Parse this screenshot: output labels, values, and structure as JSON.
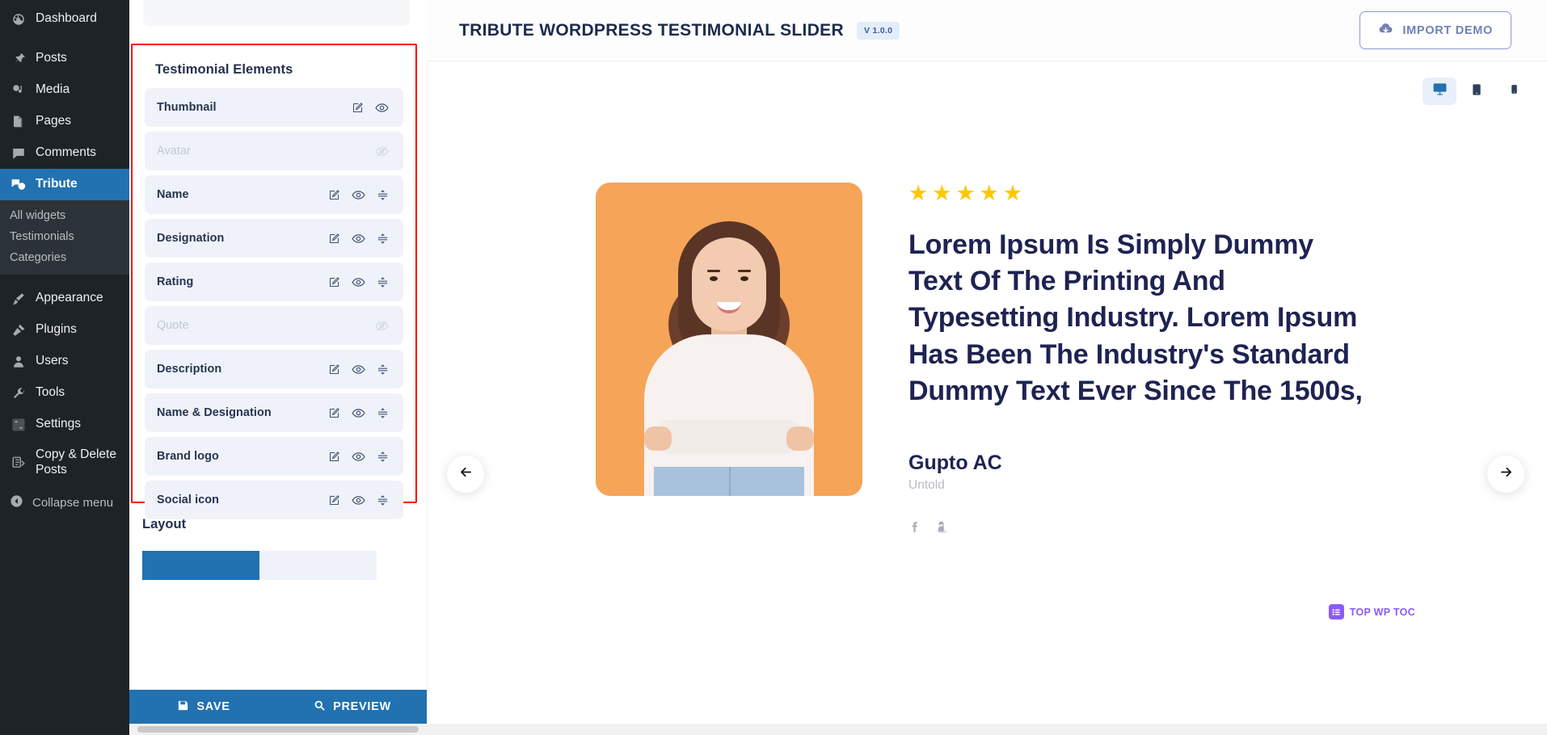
{
  "wp_sidebar": {
    "items": [
      {
        "label": "Dashboard",
        "icon": "dashboard-icon"
      },
      {
        "label": "Posts",
        "icon": "pin-icon"
      },
      {
        "label": "Media",
        "icon": "media-icon"
      },
      {
        "label": "Pages",
        "icon": "pages-icon"
      },
      {
        "label": "Comments",
        "icon": "comments-icon"
      },
      {
        "label": "Tribute",
        "icon": "tribute-icon",
        "active": true
      }
    ],
    "submenu": [
      {
        "label": "All widgets"
      },
      {
        "label": "Testimonials"
      },
      {
        "label": "Categories"
      }
    ],
    "items2": [
      {
        "label": "Appearance",
        "icon": "brush-icon"
      },
      {
        "label": "Plugins",
        "icon": "plug-icon"
      },
      {
        "label": "Users",
        "icon": "user-icon"
      },
      {
        "label": "Tools",
        "icon": "wrench-icon"
      },
      {
        "label": "Settings",
        "icon": "sliders-icon"
      },
      {
        "label": "Copy & Delete Posts",
        "icon": "copy-icon"
      }
    ],
    "collapse_label": "Collapse menu"
  },
  "left_panel": {
    "elements_heading": "Testimonial Elements",
    "elements": [
      {
        "label": "Thumbnail",
        "enabled": true,
        "has_edit": true,
        "has_eye": true,
        "has_drag": false
      },
      {
        "label": "Avatar",
        "enabled": false,
        "has_edit": false,
        "has_eye": true,
        "has_drag": false
      },
      {
        "label": "Name",
        "enabled": true,
        "has_edit": true,
        "has_eye": true,
        "has_drag": true
      },
      {
        "label": "Designation",
        "enabled": true,
        "has_edit": true,
        "has_eye": true,
        "has_drag": true
      },
      {
        "label": "Rating",
        "enabled": true,
        "has_edit": true,
        "has_eye": true,
        "has_drag": true
      },
      {
        "label": "Quote",
        "enabled": false,
        "has_edit": false,
        "has_eye": true,
        "has_drag": false
      },
      {
        "label": "Description",
        "enabled": true,
        "has_edit": true,
        "has_eye": true,
        "has_drag": true
      },
      {
        "label": "Name & Designation",
        "enabled": true,
        "has_edit": true,
        "has_eye": true,
        "has_drag": true
      },
      {
        "label": "Brand logo",
        "enabled": true,
        "has_edit": true,
        "has_eye": true,
        "has_drag": true
      },
      {
        "label": "Social icon",
        "enabled": true,
        "has_edit": true,
        "has_eye": true,
        "has_drag": true
      }
    ],
    "layout_heading": "Layout",
    "save_label": "SAVE",
    "preview_label": "PREVIEW"
  },
  "header": {
    "title": "TRIBUTE WORDPRESS TESTIMONIAL SLIDER",
    "version": "V 1.0.0",
    "import_label": "IMPORT DEMO"
  },
  "devices": [
    {
      "name": "desktop",
      "active": true
    },
    {
      "name": "tablet",
      "active": false
    },
    {
      "name": "mobile",
      "active": false
    }
  ],
  "testimonial": {
    "rating": 5,
    "stars": [
      "★",
      "★",
      "★",
      "★",
      "★"
    ],
    "quote": "Lorem Ipsum Is Simply Dummy Text Of The Printing And Typesetting Industry. Lorem Ipsum Has Been The Industry's Standard Dummy Text Ever Since The 1500s,",
    "author": "Gupto AC",
    "role": "Untold",
    "socials": [
      "facebook-icon",
      "amazon-icon"
    ]
  },
  "toc_badge": {
    "label": "TOP WP TOC"
  },
  "colors": {
    "wp_sidebar_bg": "#1d2327",
    "wp_active": "#2271b1",
    "highlight_outline": "#ff0000",
    "row_bg": "#eff3f9",
    "star": "#ffc803",
    "thumb_bg": "#f5a458",
    "quote_text": "#1e2352",
    "import_border": "#8d9bd0",
    "toc_purple": "#8b5cf6"
  }
}
